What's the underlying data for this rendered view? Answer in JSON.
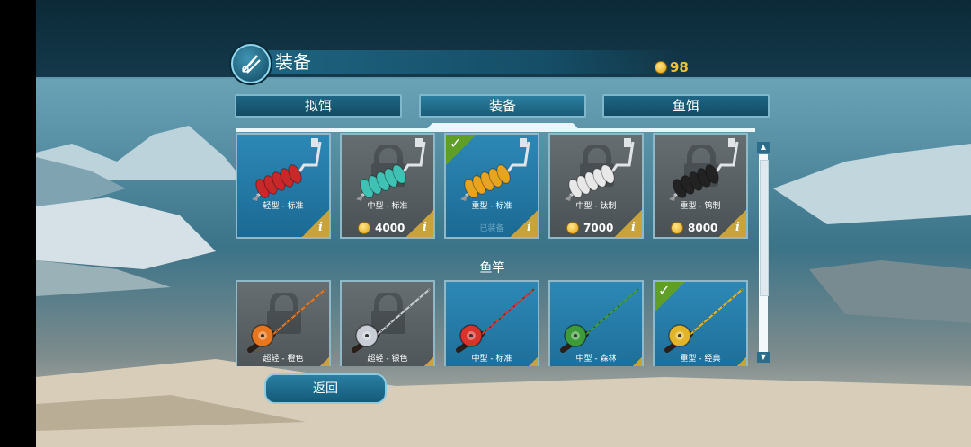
{
  "header": {
    "title": "装备",
    "coins": "98"
  },
  "tabs": [
    {
      "label": "拟饵"
    },
    {
      "label": "装备"
    },
    {
      "label": "鱼饵"
    }
  ],
  "augers": [
    {
      "name": "轻型 - 标准",
      "price": "",
      "state": "owned",
      "color": "#c8282a"
    },
    {
      "name": "中型 - 标准",
      "price": "4000",
      "state": "locked",
      "color": "#3fc2b4"
    },
    {
      "name": "重型 - 标准",
      "price": "",
      "state": "equipped",
      "equipped_label": "已装备",
      "color": "#e7a420"
    },
    {
      "name": "中型 - 钛制",
      "price": "7000",
      "state": "locked",
      "color": "#e8e8e8"
    },
    {
      "name": "重型 - 钨制",
      "price": "8000",
      "state": "locked",
      "color": "#222222"
    }
  ],
  "rod_section": {
    "title": "鱼竿"
  },
  "rods": [
    {
      "name": "超轻 - 橙色",
      "state": "locked",
      "color": "#e8761e"
    },
    {
      "name": "超轻 - 银色",
      "state": "locked",
      "color": "#c9ced6"
    },
    {
      "name": "中型 - 标准",
      "state": "owned",
      "color": "#d8342c"
    },
    {
      "name": "中型 - 森林",
      "state": "owned",
      "color": "#3e9b3a"
    },
    {
      "name": "重型 - 经典",
      "state": "equipped",
      "color": "#e2b428"
    }
  ],
  "info_glyph": "i",
  "check_glyph": "✓",
  "back_label": "返回",
  "scroll": {
    "up": "▲",
    "down": "▼"
  }
}
